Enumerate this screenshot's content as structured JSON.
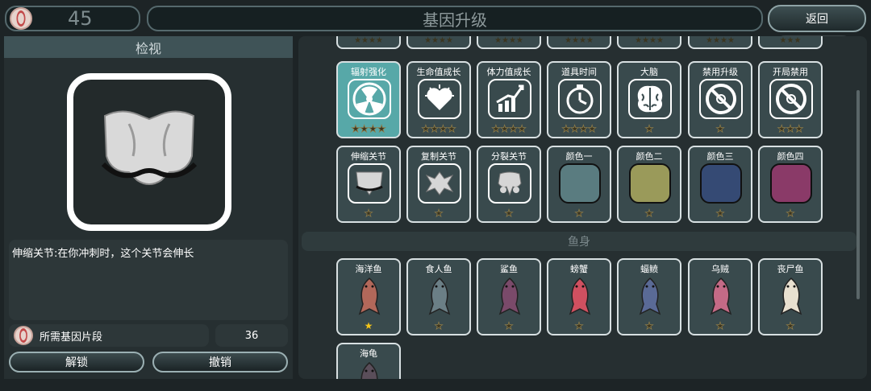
{
  "header": {
    "currency_value": "45",
    "title": "基因升级",
    "back_label": "返回",
    "menu_dots": "•••"
  },
  "left": {
    "title": "检视",
    "description": "伸缩关节:在你冲刺时，这个关节会伸长",
    "cost_label": "所需基因片段",
    "cost_value": "36",
    "unlock_label": "解锁",
    "undo_label": "撤销"
  },
  "upgrades": [
    {
      "name": "辐射强化",
      "icon": "radiation-icon",
      "stars": 4,
      "lit": 0,
      "selected": true
    },
    {
      "name": "生命值成长",
      "icon": "heart-icon",
      "stars": 4,
      "lit": 0
    },
    {
      "name": "体力值成长",
      "icon": "stamina-chart-icon",
      "stars": 4,
      "lit": 0
    },
    {
      "name": "道具时间",
      "icon": "timer-icon",
      "stars": 4,
      "lit": 0
    },
    {
      "name": "大脑",
      "icon": "brain-icon",
      "stars": 1,
      "lit": 0
    },
    {
      "name": "禁用升级",
      "icon": "ban-upgrade-icon",
      "stars": 1,
      "lit": 0
    },
    {
      "name": "开局禁用",
      "icon": "ban-start-icon",
      "stars": 3,
      "lit": 0
    },
    {
      "name": "伸缩关节",
      "icon": "joint-icon",
      "stars": 1,
      "lit": 0
    },
    {
      "name": "复制关节",
      "icon": "copy-joint-icon",
      "stars": 1,
      "lit": 0
    },
    {
      "name": "分裂关节",
      "icon": "split-joint-icon",
      "stars": 1,
      "lit": 0
    },
    {
      "name": "颜色一",
      "icon": "color-swatch",
      "color": "#5a7c80",
      "stars": 1,
      "lit": 0
    },
    {
      "name": "颜色二",
      "icon": "color-swatch",
      "color": "#9a9a5a",
      "stars": 1,
      "lit": 0
    },
    {
      "name": "颜色三",
      "icon": "color-swatch",
      "color": "#354a74",
      "stars": 1,
      "lit": 0
    },
    {
      "name": "颜色四",
      "icon": "color-swatch",
      "color": "#8a3a68",
      "stars": 1,
      "lit": 0
    }
  ],
  "fish_section_title": "鱼身",
  "fish": [
    {
      "name": "海洋鱼",
      "icon": "ocean-fish-icon",
      "stars": 1,
      "lit": 1
    },
    {
      "name": "食人鱼",
      "icon": "piranha-icon",
      "stars": 1,
      "lit": 0
    },
    {
      "name": "鲨鱼",
      "icon": "shark-icon",
      "stars": 1,
      "lit": 0
    },
    {
      "name": "螃蟹",
      "icon": "crab-icon",
      "stars": 1,
      "lit": 0
    },
    {
      "name": "蝠鲼",
      "icon": "manta-icon",
      "stars": 1,
      "lit": 0
    },
    {
      "name": "乌贼",
      "icon": "squid-icon",
      "stars": 1,
      "lit": 0
    },
    {
      "name": "丧尸鱼",
      "icon": "zombie-fish-icon",
      "stars": 1,
      "lit": 0
    },
    {
      "name": "海龟",
      "icon": "turtle-icon",
      "stars": 0,
      "lit": 0
    }
  ]
}
